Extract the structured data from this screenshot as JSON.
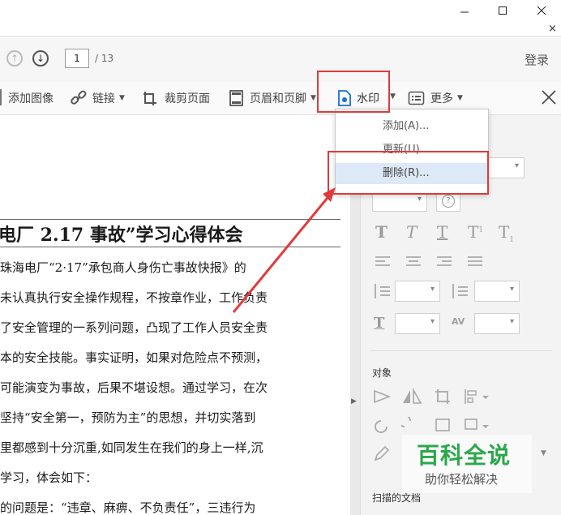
{
  "window": {
    "close_tab_glyph": "×"
  },
  "nav": {
    "page_current": "1",
    "page_total": "/ 13",
    "login_label": "登录"
  },
  "toolbar": {
    "add_image": "添加图像",
    "link": "链接",
    "crop": "裁剪页面",
    "header_footer": "页眉和页脚",
    "watermark": "水印",
    "more": "更多"
  },
  "watermark_menu": {
    "items": [
      "添加(A)...",
      "更新(U)...",
      "删除(R)..."
    ],
    "selected_index": 2
  },
  "document": {
    "title": "电厂 2.17 事故”学习心得体会",
    "lines": [
      "珠海电厂“2·17”承包商人身伤亡事故快报》的",
      "未认真执行安全操作规程，不按章作业，工作负责",
      "了安全管理的一系列问题，凸现了工作人员安全责",
      "本的安全技能。事实证明，如果对危险点不预测，",
      "可能演变为事故，后果不堪设想。通过学习，在次",
      "坚持“安全第一，预防为主”的思想，并切实落到",
      "里都感到十分沉重,如同发生在我们的身上一样,沉",
      "学习，体会如下：",
      "的问题是：“违章、麻痹、不负责任”，三违行为"
    ]
  },
  "panel": {
    "objects_label": "对象",
    "scanned_label": "扫描的文档"
  },
  "branding": {
    "title": "百科全说",
    "subtitle": "助你轻松解决"
  },
  "colors": {
    "highlight_red": "#e23a3a",
    "accent_blue": "#1c6fd1",
    "brand_green": "#2aa84a"
  }
}
